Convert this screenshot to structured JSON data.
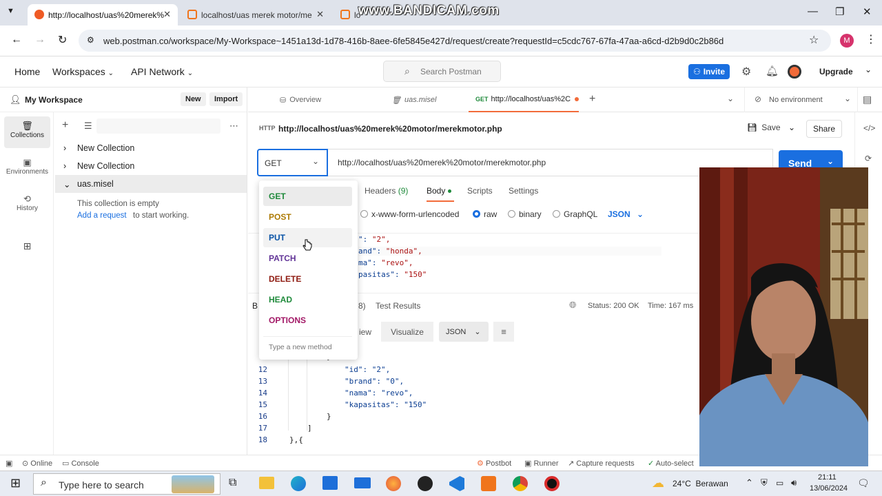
{
  "browser": {
    "tabs": [
      {
        "title": "http://localhost/uas%20merek%"
      },
      {
        "title": "localhost/uas merek motor/me"
      },
      {
        "title": "lo"
      }
    ],
    "watermark": "www.BANDICAM.com",
    "url": "web.postman.co/workspace/My-Workspace~1451a13d-1d78-416b-8aee-6fe5845e427d/request/create?requestId=c5cdc767-67fa-47aa-a6cd-d2b9d0c2b86d",
    "profile_initial": "M"
  },
  "header": {
    "home": "Home",
    "workspaces": "Workspaces",
    "api_network": "API Network",
    "search_placeholder": "Search Postman",
    "invite": "Invite",
    "upgrade": "Upgrade"
  },
  "sidebar": {
    "workspace_name": "My Workspace",
    "new_btn": "New",
    "import_btn": "Import",
    "rail": [
      {
        "label": "Collections"
      },
      {
        "label": "Environments"
      },
      {
        "label": "History"
      }
    ],
    "collections": [
      {
        "name": "New Collection"
      },
      {
        "name": "New Collection"
      },
      {
        "name": "uas.misel"
      }
    ],
    "empty_text": "This collection is empty",
    "add_request": "Add a request",
    "start_working": "to start working."
  },
  "tabs": {
    "overview": "Overview",
    "collection": "uas.misel",
    "request_method": "GET",
    "request_title": "http://localhost/uas%2C",
    "environment": "No environment"
  },
  "request": {
    "title": "http://localhost/uas%20merek%20motor/merekmotor.php",
    "save": "Save",
    "share": "Share",
    "method": "GET",
    "url": "http://localhost/uas%20merek%20motor/merekmotor.php",
    "send": "Send",
    "subtabs": {
      "headers": "Headers",
      "headers_count": "(9)",
      "body": "Body",
      "scripts": "Scripts",
      "settings": "Settings"
    },
    "body_types": {
      "urlencoded": "x-www-form-urlencoded",
      "raw": "raw",
      "binary": "binary",
      "graphql": "GraphQL",
      "format": "JSON"
    },
    "body_lines": [
      {
        "key": "\": ",
        "val": "\"2\","
      },
      {
        "key": "and\": ",
        "val": "\"honda\","
      },
      {
        "key": "ma\": ",
        "val": "\"revo\","
      },
      {
        "key": "pasitas\": ",
        "val": "\"150\""
      }
    ]
  },
  "method_dropdown": {
    "options": [
      {
        "label": "GET",
        "color": "#1f8a3b"
      },
      {
        "label": "POST",
        "color": "#ad7a03"
      },
      {
        "label": "PUT",
        "color": "#0953a6"
      },
      {
        "label": "PATCH",
        "color": "#623497"
      },
      {
        "label": "DELETE",
        "color": "#8e1a10"
      },
      {
        "label": "HEAD",
        "color": "#1f8a3b"
      },
      {
        "label": "OPTIONS",
        "color": "#a21866"
      }
    ],
    "placeholder": "Type a new method"
  },
  "response": {
    "b": "B",
    "count_suffix": "8)",
    "test_results": "Test Results",
    "status": "Status: 200 OK",
    "time": "Time: 167 ms",
    "view_partial": "iew",
    "visualize": "Visualize",
    "format": "JSON",
    "lines": [
      {
        "n": "12",
        "text": "\"id\": \"2\","
      },
      {
        "n": "13",
        "text": "\"brand\": \"0\","
      },
      {
        "n": "14",
        "text": "\"nama\": \"revo\","
      },
      {
        "n": "15",
        "text": "\"kapasitas\": \"150\""
      },
      {
        "n": "16",
        "text": "}"
      },
      {
        "n": "17",
        "text": "]"
      },
      {
        "n": "18",
        "text": "},{"
      }
    ]
  },
  "statusbar": {
    "online": "Online",
    "console": "Console",
    "postbot": "Postbot",
    "runner": "Runner",
    "capture": "Capture requests",
    "autoselect": "Auto-select"
  },
  "taskbar": {
    "search_placeholder": "Type here to search",
    "weather": "24°C  Berawan",
    "time": "21:11",
    "date": "13/06/2024"
  }
}
